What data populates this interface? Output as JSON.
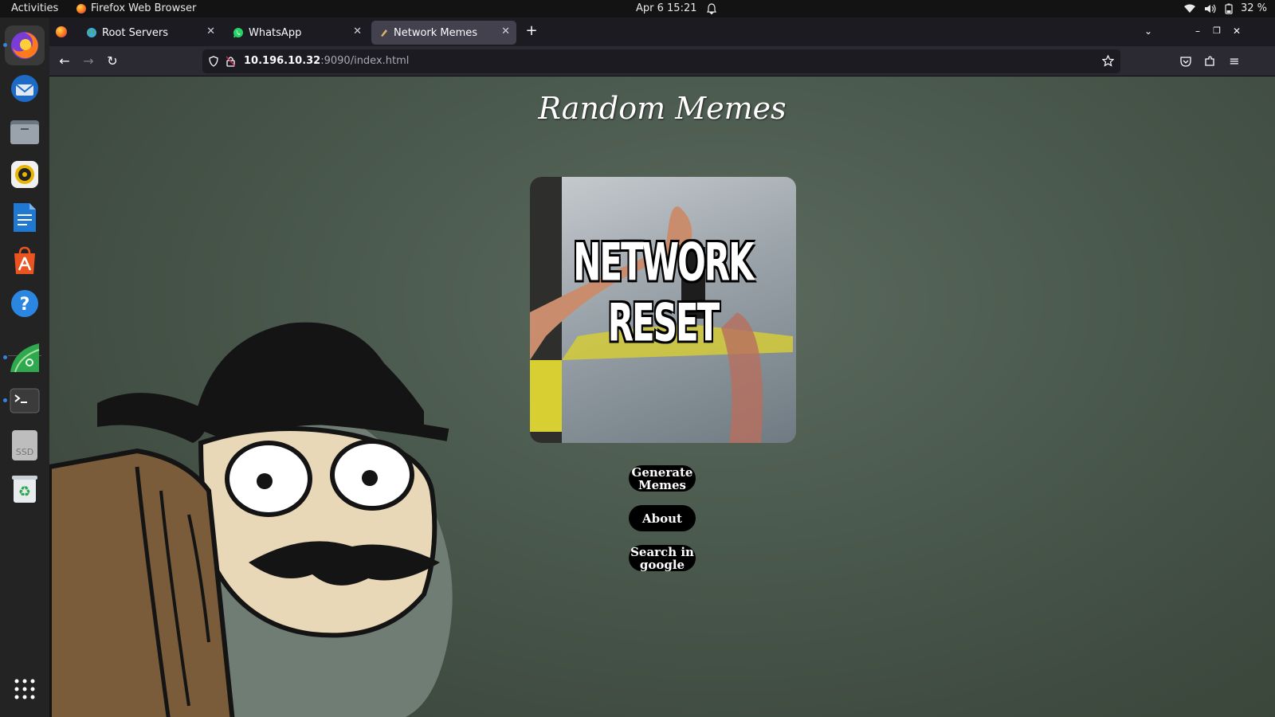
{
  "system": {
    "activities_label": "Activities",
    "app_name": "Firefox Web Browser",
    "datetime": "Apr 6  15:21",
    "battery": "32 %"
  },
  "dock": {
    "items": [
      "firefox-icon",
      "thunderbird-icon",
      "files-icon",
      "rhythmbox-icon",
      "writer-icon",
      "app-center-icon",
      "help-icon",
      "cloud-app-icon",
      "terminal-icon",
      "ssd-icon",
      "trash-icon",
      "app-grid-icon"
    ],
    "ssd_label": "SSD"
  },
  "tabs": [
    {
      "label": "Root Servers",
      "icon": "globe-icon"
    },
    {
      "label": "WhatsApp",
      "icon": "whatsapp-icon"
    },
    {
      "label": "Network Memes",
      "icon": "page-icon",
      "active": true
    }
  ],
  "url": {
    "host": "10.196.10.32",
    "rest": ":9090/index.html"
  },
  "page": {
    "title": "Random Memes",
    "meme_text": "NETWORK RESET",
    "buttons": {
      "generate": "Generate Memes",
      "about": "About",
      "search": "Search in google"
    }
  },
  "colors": {
    "background": "#4b5a4e",
    "button": "#000000",
    "accent": "#3584e4"
  }
}
